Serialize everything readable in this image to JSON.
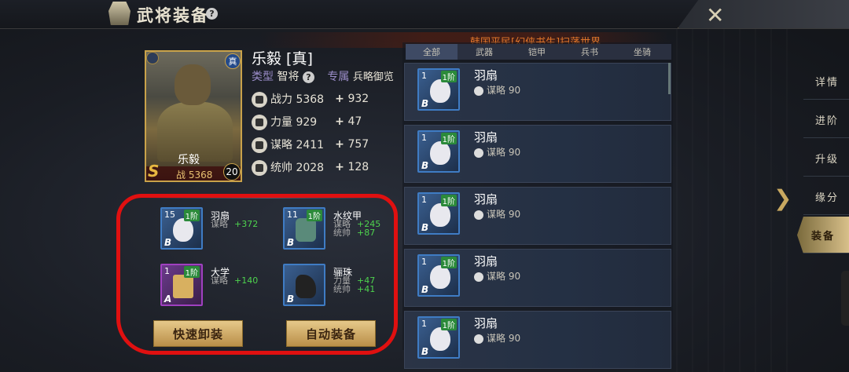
{
  "header": {
    "title": "武将装备",
    "help_icon": "?",
    "close_label": "✕"
  },
  "ticker": {
    "text": "韩国平民[幻侠书生]扫荡世界"
  },
  "hero": {
    "name": "乐毅 [真]",
    "type_label": "类型",
    "type_value": "智将",
    "exclusive_label": "专属",
    "exclusive_value": "兵略御览",
    "portrait_name": "乐毅",
    "portrait_power_prefix": "战",
    "portrait_power": "5368",
    "grade": "S",
    "level": "20",
    "zhen": "真",
    "stats": [
      {
        "icon": "sword-icon",
        "label": "战力",
        "value": "5368",
        "bonus": "932"
      },
      {
        "icon": "fist-icon",
        "label": "力量",
        "value": "929",
        "bonus": "47"
      },
      {
        "icon": "brain-icon",
        "label": "谋略",
        "value": "2411",
        "bonus": "757"
      },
      {
        "icon": "helmet-icon",
        "label": "统帅",
        "value": "2028",
        "bonus": "128"
      }
    ]
  },
  "equipped": [
    {
      "name": "羽扇",
      "num": "15",
      "lvl": "1阶",
      "grade": "B",
      "quality": "blue",
      "art": "fan",
      "attrs": [
        {
          "k": "谋略",
          "v": "+372"
        }
      ]
    },
    {
      "name": "水纹甲",
      "num": "11",
      "lvl": "1阶",
      "grade": "B",
      "quality": "blue",
      "art": "armor",
      "attrs": [
        {
          "k": "谋略",
          "v": "+245"
        },
        {
          "k": "统帅",
          "v": "+87"
        }
      ]
    },
    {
      "name": "大学",
      "num": "1",
      "lvl": "1阶",
      "grade": "A",
      "quality": "purple",
      "art": "scroll",
      "attrs": [
        {
          "k": "谋略",
          "v": "+140"
        }
      ]
    },
    {
      "name": "骊珠",
      "num": "",
      "lvl": "",
      "grade": "B",
      "quality": "blue",
      "art": "horse",
      "attrs": [
        {
          "k": "力量",
          "v": "+47"
        },
        {
          "k": "统帅",
          "v": "+41"
        }
      ]
    }
  ],
  "buttons": {
    "quick_unequip": "快速卸装",
    "auto_equip": "自动装备"
  },
  "tabs": [
    "全部",
    "武器",
    "铠甲",
    "兵书",
    "坐骑"
  ],
  "list": [
    {
      "name": "羽扇",
      "num": "1",
      "lvl": "1阶",
      "grade": "B",
      "stat": "谋略",
      "value": "90"
    },
    {
      "name": "羽扇",
      "num": "1",
      "lvl": "1阶",
      "grade": "B",
      "stat": "谋略",
      "value": "90"
    },
    {
      "name": "羽扇",
      "num": "1",
      "lvl": "1阶",
      "grade": "B",
      "stat": "谋略",
      "value": "90"
    },
    {
      "name": "羽扇",
      "num": "1",
      "lvl": "1阶",
      "grade": "B",
      "stat": "谋略",
      "value": "90"
    },
    {
      "name": "羽扇",
      "num": "1",
      "lvl": "1阶",
      "grade": "B",
      "stat": "谋略",
      "value": "90"
    }
  ],
  "side_menu": [
    "详情",
    "进阶",
    "升级",
    "缘分",
    "装备"
  ],
  "side_active": "装备"
}
